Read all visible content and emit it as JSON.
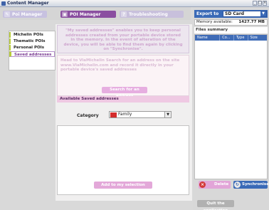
{
  "window": {
    "title": "Content Manager",
    "controls": [
      "_",
      "□",
      "×"
    ]
  },
  "tabs": [
    {
      "label": "Poi Manager",
      "icon": "poi-icon"
    },
    {
      "label": "POI Manager",
      "icon": "poi-manager-icon"
    },
    {
      "label": "Troubleshooting",
      "icon": "troubleshooting-icon"
    }
  ],
  "sidebar": {
    "items": [
      {
        "label": "Michelin POIs"
      },
      {
        "label": "Thematic POIs"
      },
      {
        "label": "Personal POIs"
      },
      {
        "label": "Saved addresses",
        "active": true
      }
    ]
  },
  "main": {
    "info_text": "\"My saved addresses\" enables you to keep personal addresses created from your portable device stored in the memory. In the event of alteration of the device, you will be able to find them again by clicking on \"Synchronise\".",
    "search_text": "Head to ViaMichelin Search for an address on the site www.ViaMichelin.com and record it directly in your portable device's saved addresses",
    "search_button": "Search for an address",
    "available_heading": "Available Saved addresses",
    "category_label": "Category",
    "category_value": "Family",
    "add_button": "Add to my selection"
  },
  "right": {
    "export_label": "Export to",
    "export_value": "SD Card",
    "memory_label": "Memory available:",
    "memory_value": "1427.77 MB",
    "files_summary_heading": "Files summary",
    "columns": [
      "Name",
      "Co...",
      "Type",
      "Size"
    ],
    "delete_button": "Delete",
    "sync_button": "Synchronise",
    "quit_button": "Quit the application"
  },
  "colors": {
    "accent_purple": "#8a4ea0",
    "accent_pink": "#e3a8d9",
    "accent_blue": "#3a6ab7",
    "sidebar_marker": "#b8cc3a"
  }
}
